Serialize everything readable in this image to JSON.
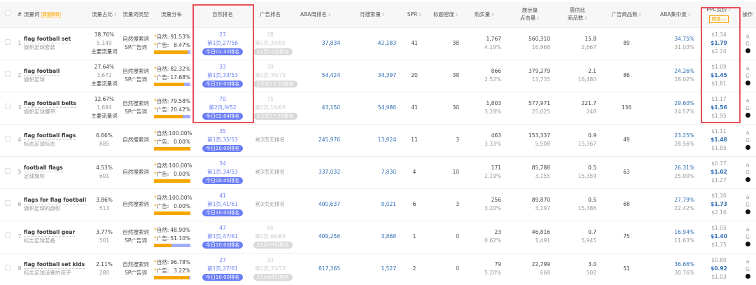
{
  "header": {
    "keyword": "流量词",
    "keyword_tag": "数据解释",
    "share": "流量占比",
    "type": "流量词类型",
    "dist": "流量分布",
    "natural": "自然排名",
    "ad": "广告排名",
    "aba_rank": "ABA周排名",
    "monthly": "月搜索量",
    "spr": "SPR",
    "title_density": "标题密度",
    "purchase": "购买量",
    "impressions": "展示量",
    "clicks": "点击量",
    "supply_ratio": "需供比",
    "products": "商品数",
    "ad_products": "广告商品数",
    "aba_conc": "ABA集中度",
    "ppc": "PPC竞价",
    "ppc_mode": "精准",
    "ops": "操作",
    "index": "#"
  },
  "labels": {
    "nat": "自然:",
    "ad": "广告:",
    "no_ad": "前3页无排名"
  },
  "colors": {
    "natural_bar": "#f5a700",
    "ad_bar": "#a3aefc",
    "rank_pill": "#6b7ef5",
    "highlight_box": "#e9505a"
  },
  "rows": [
    {
      "i": "1",
      "en": "flag football set",
      "zh": "旗帜足球套装",
      "share": "38.76%",
      "cnt": "5,149",
      "main": "主要流量词",
      "t1": "自然搜索词",
      "t2": "SP广告词",
      "np": "91.53%",
      "ap": "8.47%",
      "nf": 91.53,
      "nr": "27",
      "npage": "第1页,27/56",
      "ntime": "今日01:32排名",
      "ar": "38",
      "apage": "第1页,38/85",
      "atime": "12月12日排名",
      "aba": "37,834",
      "mon": "42,183",
      "spr": "41",
      "td": "38",
      "buy": "1,767",
      "buyp": "4.19%",
      "imp": "560,310",
      "clk": "16,968",
      "sr": "15.8",
      "prod": "2,667",
      "adp": "89",
      "c1": "34.75%",
      "c2": "31.03%",
      "p1": "$1.34",
      "p2": "$1.79",
      "p3": "$2.24"
    },
    {
      "i": "2",
      "en": "flag football",
      "zh": "旗帜足球",
      "share": "27.64%",
      "cnt": "3,672",
      "main": "主要流量词",
      "t1": "自然搜索词",
      "t2": "SP广告词",
      "np": "82.32%",
      "ap": "17.68%",
      "nf": 82.32,
      "nr": "33",
      "npage": "第1页,33/53",
      "ntime": "今日10:00排名",
      "ar": "39",
      "apage": "第1页,39/73",
      "atime": "2天前13:55排名",
      "aba": "54,424",
      "mon": "34,397",
      "spr": "20",
      "td": "38",
      "buy": "866",
      "buyp": "2.52%",
      "imp": "379,279",
      "clk": "13,735",
      "sr": "2.1",
      "prod": "16,480",
      "adp": "86",
      "c1": "24.26%",
      "c2": "28.02%",
      "p1": "$1.09",
      "p2": "$1.45",
      "p3": "$1.81"
    },
    {
      "i": "3",
      "en": "flag football belts",
      "zh": "旗帜足球腰带",
      "share": "12.67%",
      "cnt": "1,684",
      "main": "主要流量词",
      "t1": "自然搜索词",
      "t2": "SP广告词",
      "np": "79.58%",
      "ap": "20.42%",
      "nf": 79.58,
      "nr": "70",
      "npage": "第2页,9/52",
      "ntime": "今日02:04排名",
      "ar": "75",
      "apage": "第2页,19/69",
      "atime": "2天前17:52排名",
      "aba": "43,150",
      "mon": "54,986",
      "spr": "41",
      "td": "30",
      "buy": "1,803",
      "buyp": "3.28%",
      "imp": "577,971",
      "clk": "25,025",
      "sr": "221.7",
      "prod": "248",
      "adp": "136",
      "c1": "29.60%",
      "c2": "24.57%",
      "p1": "$1.17",
      "p2": "$1.56",
      "p3": "$1.95"
    },
    {
      "i": "4",
      "en": "flag football flags",
      "zh": "标志足球标志",
      "share": "6.66%",
      "cnt": "885",
      "main": "",
      "t1": "自然搜索词",
      "t2": "",
      "np": "100.00%",
      "ap": "0.00%",
      "nf": 100,
      "nr": "35",
      "npage": "第1页,35/53",
      "ntime": "今日10:00排名",
      "ar": "",
      "apage": "",
      "atime": "",
      "aba": "245,976",
      "mon": "13,924",
      "spr": "11",
      "td": "3",
      "buy": "463",
      "buyp": "3.33%",
      "imp": "153,337",
      "clk": "5,508",
      "sr": "0.9",
      "prod": "15,367",
      "adp": "49",
      "c1": "23.25%",
      "c2": "28.56%",
      "p1": "$1.11",
      "p2": "$1.48",
      "p3": "$1.85"
    },
    {
      "i": "5",
      "en": "football flags",
      "zh": "足球旗帜",
      "share": "4.53%",
      "cnt": "601",
      "main": "",
      "t1": "自然搜索词",
      "t2": "",
      "np": "100.00%",
      "ap": "0.00%",
      "nf": 100,
      "nr": "34",
      "npage": "第1页,34/53",
      "ntime": "今日00:45排名",
      "ar": "",
      "apage": "",
      "atime": "",
      "aba": "337,032",
      "mon": "7,830",
      "spr": "4",
      "td": "10",
      "buy": "171",
      "buyp": "2.19%",
      "imp": "85,788",
      "clk": "3,155",
      "sr": "0.5",
      "prod": "15,359",
      "adp": "63",
      "c1": "26.31%",
      "c2": "25.00%",
      "p1": "$0.77",
      "p2": "$1.02",
      "p3": "$1.27"
    },
    {
      "i": "6",
      "en": "flags for flag football",
      "zh": "旗帜足球的旗帜",
      "share": "3.86%",
      "cnt": "513",
      "main": "",
      "t1": "自然搜索词",
      "t2": "",
      "np": "100.00%",
      "ap": "0.00%",
      "nf": 100,
      "nr": "41",
      "npage": "第1页,41/61",
      "ntime": "今日10:00排名",
      "ar": "",
      "apage": "",
      "atime": "",
      "aba": "400,637",
      "mon": "8,021",
      "spr": "6",
      "td": "3",
      "buy": "256",
      "buyp": "3.20%",
      "imp": "89,870",
      "clk": "3,197",
      "sr": "0.5",
      "prod": "15,386",
      "adp": "68",
      "c1": "27.79%",
      "c2": "22.42%",
      "p1": "$1.30",
      "p2": "$1.73",
      "p3": "$2.16"
    },
    {
      "i": "7",
      "en": "flag football gear",
      "zh": "标志足球装备",
      "share": "3.77%",
      "cnt": "501",
      "main": "",
      "t1": "自然搜索词",
      "t2": "SP广告词",
      "np": "48.90%",
      "ap": "51.10%",
      "nf": 48.9,
      "nr": "47",
      "npage": "第1页,47/61",
      "ntime": "今日10:00排名",
      "ar": "66",
      "apage": "第1页,66/69",
      "atime": "12月08日排名",
      "aba": "409,256",
      "mon": "3,868",
      "spr": "1",
      "td": "0",
      "buy": "23",
      "buyp": "0.62%",
      "imp": "46,816",
      "clk": "1,491",
      "sr": "0.7",
      "prod": "5,945",
      "adp": "75",
      "c1": "16.94%",
      "c2": "11.63%",
      "p1": "$1.05",
      "p2": "$1.40",
      "p3": "$1.75"
    },
    {
      "i": "8",
      "en": "flag football set kids",
      "zh": "标志足球设置的孩子",
      "share": "2.11%",
      "cnt": "280",
      "main": "",
      "t1": "自然搜索词",
      "t2": "SP广告词",
      "np": "96.78%",
      "ap": "3.22%",
      "nf": 96.78,
      "nr": "27",
      "npage": "第1页,27/61",
      "ntime": "今日10:00排名",
      "ar": "33",
      "apage": "第1页,33/73",
      "atime": "12月06日排名",
      "aba": "817,365",
      "mon": "1,527",
      "spr": "2",
      "td": "0",
      "buy": "79",
      "buyp": "5.20%",
      "imp": "22,799",
      "clk": "668",
      "sr": "3.0",
      "prod": "502",
      "adp": "51",
      "c1": "36.66%",
      "c2": "30.76%",
      "p1": "$0.80",
      "p2": "$0.92",
      "p3": "$1.03"
    }
  ]
}
